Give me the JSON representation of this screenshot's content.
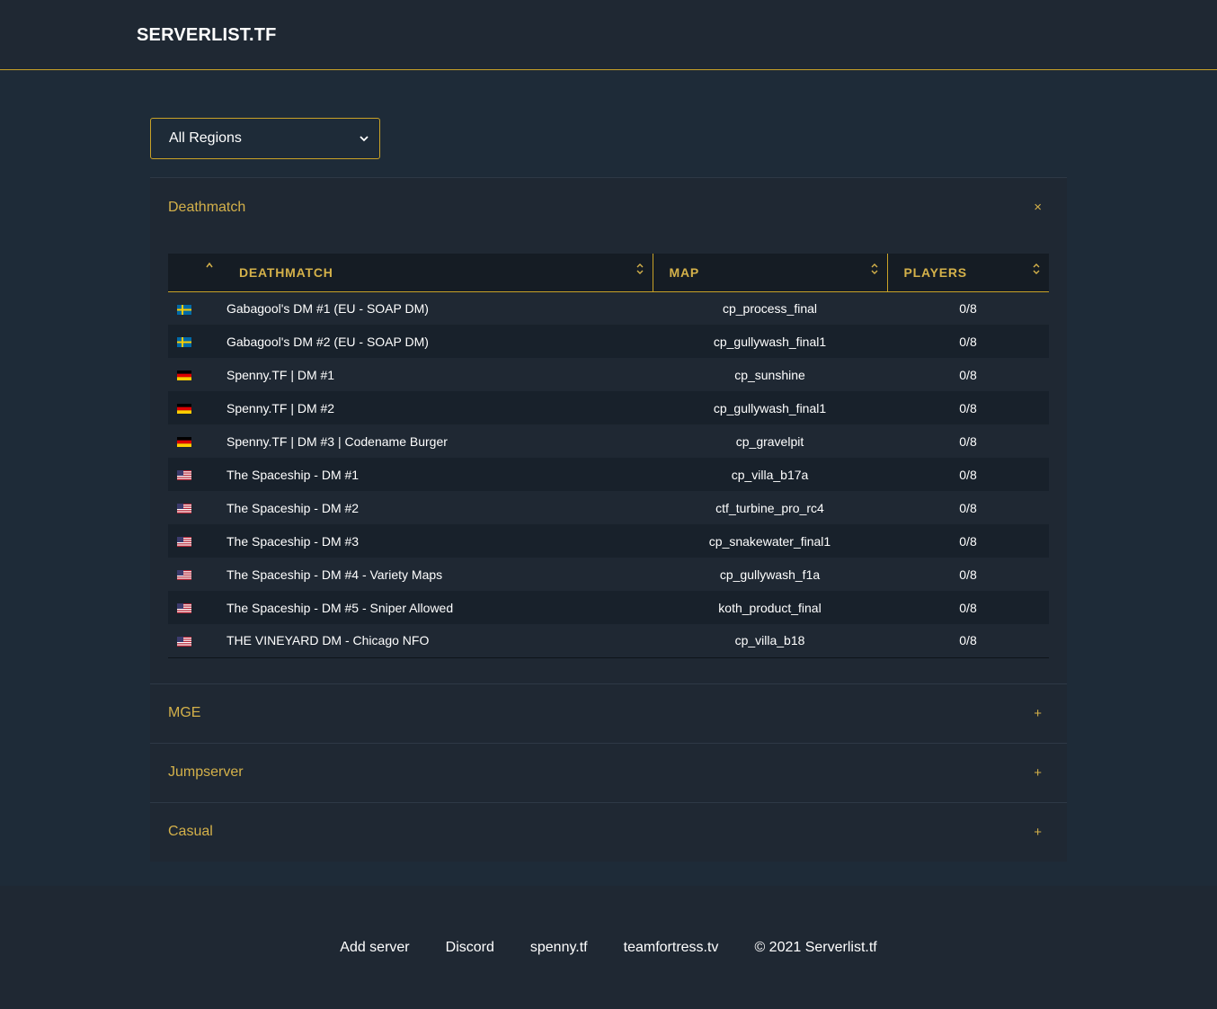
{
  "header": {
    "brand": "SERVERLIST.TF"
  },
  "filter": {
    "region_selected": "All Regions"
  },
  "accent_color": "#d4b14a",
  "panels": [
    {
      "title": "Deathmatch",
      "toggle": "×",
      "open": true,
      "table": {
        "columns": [
          "DEATHMATCH",
          "MAP",
          "PLAYERS"
        ],
        "rows": [
          {
            "flag": "se",
            "name": "Gabagool's DM #1 (EU - SOAP DM)",
            "map": "cp_process_final",
            "players": "0/8"
          },
          {
            "flag": "se",
            "name": "Gabagool's DM #2 (EU - SOAP DM)",
            "map": "cp_gullywash_final1",
            "players": "0/8"
          },
          {
            "flag": "de",
            "name": "Spenny.TF | DM #1",
            "map": "cp_sunshine",
            "players": "0/8"
          },
          {
            "flag": "de",
            "name": "Spenny.TF | DM #2",
            "map": "cp_gullywash_final1",
            "players": "0/8"
          },
          {
            "flag": "de",
            "name": "Spenny.TF | DM #3 | Codename Burger",
            "map": "cp_gravelpit",
            "players": "0/8"
          },
          {
            "flag": "us",
            "name": "The Spaceship - DM #1",
            "map": "cp_villa_b17a",
            "players": "0/8"
          },
          {
            "flag": "us",
            "name": "The Spaceship - DM #2",
            "map": "ctf_turbine_pro_rc4",
            "players": "0/8"
          },
          {
            "flag": "us",
            "name": "The Spaceship - DM #3",
            "map": "cp_snakewater_final1",
            "players": "0/8"
          },
          {
            "flag": "us",
            "name": "The Spaceship - DM #4 - Variety Maps",
            "map": "cp_gullywash_f1a",
            "players": "0/8"
          },
          {
            "flag": "us",
            "name": "The Spaceship - DM #5 - Sniper Allowed",
            "map": "koth_product_final",
            "players": "0/8"
          },
          {
            "flag": "us",
            "name": "THE VINEYARD DM - Chicago NFO",
            "map": "cp_villa_b18",
            "players": "0/8"
          }
        ]
      }
    },
    {
      "title": "MGE",
      "toggle": "+",
      "open": false
    },
    {
      "title": "Jumpserver",
      "toggle": "+",
      "open": false
    },
    {
      "title": "Casual",
      "toggle": "+",
      "open": false
    }
  ],
  "footer": {
    "links": [
      "Add server",
      "Discord",
      "spenny.tf",
      "teamfortress.tv"
    ],
    "copyright": "© 2021 Serverlist.tf"
  }
}
